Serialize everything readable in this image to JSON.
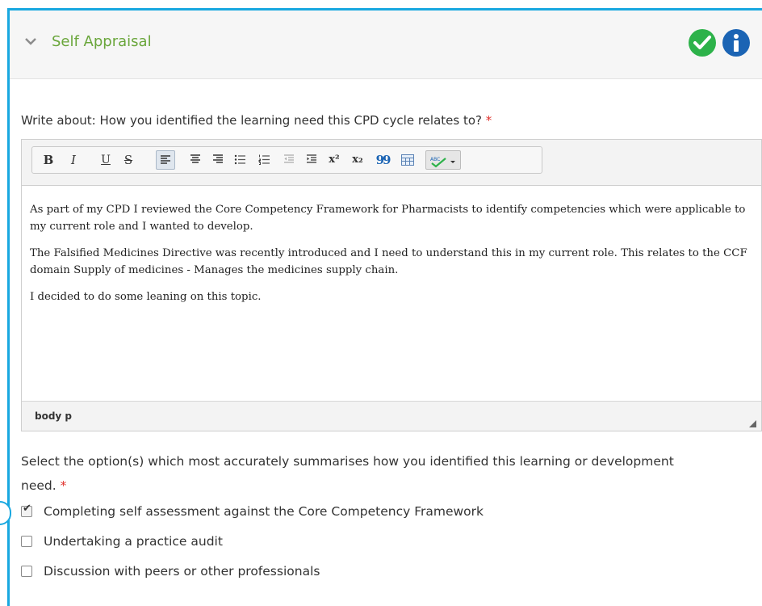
{
  "section": {
    "title": "Self Appraisal",
    "status_icon": "check-circle-icon",
    "info_icon": "info-circle-icon",
    "colors": {
      "accent": "#18a8e0",
      "title": "#6aa63b",
      "ok": "#2db24a",
      "info": "#1b64b4",
      "required": "#e0302b"
    }
  },
  "question1": {
    "label": "Write about: How you identified the learning need this CPD cycle relates to?",
    "required_mark": "*"
  },
  "editor": {
    "toolbar": [
      {
        "name": "bold",
        "glyph": "B"
      },
      {
        "name": "italic",
        "glyph": "I"
      },
      {
        "name": "underline",
        "glyph": "U"
      },
      {
        "name": "strikethrough",
        "glyph": "S"
      },
      {
        "name": "align-left",
        "glyph": ""
      },
      {
        "name": "align-center",
        "glyph": ""
      },
      {
        "name": "align-right",
        "glyph": ""
      },
      {
        "name": "bulleted-list",
        "glyph": ""
      },
      {
        "name": "numbered-list",
        "glyph": ""
      },
      {
        "name": "outdent",
        "glyph": ""
      },
      {
        "name": "indent",
        "glyph": ""
      },
      {
        "name": "superscript",
        "glyph": "x²"
      },
      {
        "name": "subscript",
        "glyph": "x₂"
      },
      {
        "name": "blockquote",
        "glyph": "99"
      },
      {
        "name": "table",
        "glyph": ""
      },
      {
        "name": "spellcheck",
        "glyph": "ABC"
      }
    ],
    "paragraphs": [
      "As part of my CPD I reviewed the Core Competency Framework for Pharmacists to identify competencies which were applicable to my current role and I wanted to develop.",
      "The Falsified Medicines Directive was recently introduced and I need to understand this in my current role. This relates to the CCF domain Supply of medicines -  Manages the medicines supply chain.",
      "I decided to do some leaning on this topic."
    ],
    "path": "body  p"
  },
  "question2": {
    "label": "Select the option(s) which most accurately summarises how you identified this learning or development need.",
    "required_mark": "*",
    "options": [
      {
        "label": "Completing self assessment against the Core Competency Framework",
        "checked": true
      },
      {
        "label": "Undertaking a practice audit",
        "checked": false
      },
      {
        "label": "Discussion with peers or other professionals",
        "checked": false
      }
    ]
  }
}
